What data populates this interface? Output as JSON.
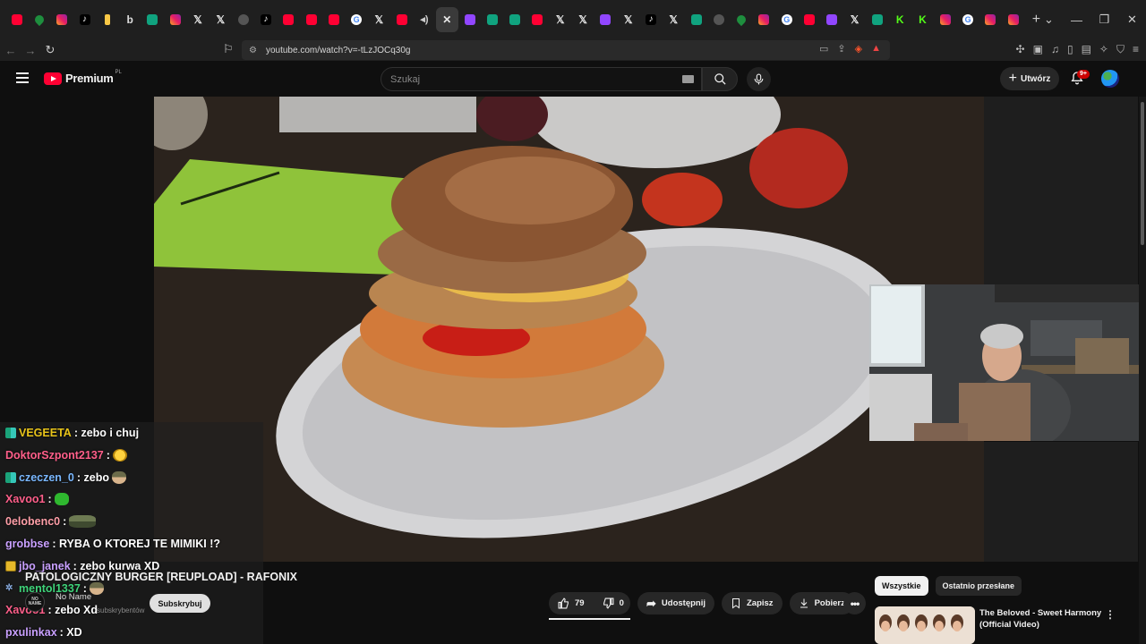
{
  "browser": {
    "tabs": [
      {
        "icon": "youtube-icon",
        "glyph": ""
      },
      {
        "icon": "maps-icon",
        "glyph": ""
      },
      {
        "icon": "instagram-icon",
        "glyph": ""
      },
      {
        "icon": "tiktok-icon",
        "glyph": "♪"
      },
      {
        "icon": "bookmark-gold-icon",
        "glyph": ""
      },
      {
        "icon": "b-icon",
        "glyph": "b"
      },
      {
        "icon": "chatgpt-icon",
        "glyph": ""
      },
      {
        "icon": "instagram-icon",
        "glyph": ""
      },
      {
        "icon": "x-icon",
        "glyph": "𝕏"
      },
      {
        "icon": "x-icon",
        "glyph": "𝕏"
      },
      {
        "icon": "misc-icon",
        "glyph": ""
      },
      {
        "icon": "tiktok-icon",
        "glyph": "♪"
      },
      {
        "icon": "youtube-icon",
        "glyph": ""
      },
      {
        "icon": "youtube-icon",
        "glyph": ""
      },
      {
        "icon": "youtube-icon",
        "glyph": ""
      },
      {
        "icon": "google-icon",
        "glyph": "G"
      },
      {
        "icon": "x-icon",
        "glyph": "𝕏"
      },
      {
        "icon": "youtube-icon",
        "glyph": ""
      },
      {
        "icon": "speaker-icon",
        "glyph": "◂)"
      },
      {
        "icon": "close-tab-icon",
        "glyph": "✕",
        "active": true
      },
      {
        "icon": "twitch-icon",
        "glyph": ""
      },
      {
        "icon": "chatgpt-icon",
        "glyph": ""
      },
      {
        "icon": "chatgpt-icon",
        "glyph": ""
      },
      {
        "icon": "youtube-icon",
        "glyph": ""
      },
      {
        "icon": "x-icon",
        "glyph": "𝕏"
      },
      {
        "icon": "x-icon",
        "glyph": "𝕏"
      },
      {
        "icon": "twitch-icon",
        "glyph": ""
      },
      {
        "icon": "x-icon",
        "glyph": "𝕏"
      },
      {
        "icon": "tiktok-icon",
        "glyph": "♪"
      },
      {
        "icon": "x-icon",
        "glyph": "𝕏"
      },
      {
        "icon": "chatgpt-icon",
        "glyph": ""
      },
      {
        "icon": "misc-icon",
        "glyph": ""
      },
      {
        "icon": "maps-icon",
        "glyph": ""
      },
      {
        "icon": "instagram-icon",
        "glyph": ""
      },
      {
        "icon": "google-icon",
        "glyph": "G"
      },
      {
        "icon": "youtube-icon",
        "glyph": ""
      },
      {
        "icon": "twitch-icon",
        "glyph": ""
      },
      {
        "icon": "x-icon",
        "glyph": "𝕏"
      },
      {
        "icon": "chatgpt-icon",
        "glyph": ""
      },
      {
        "icon": "kick-icon",
        "glyph": "K"
      },
      {
        "icon": "kick-icon",
        "glyph": "K"
      },
      {
        "icon": "instagram-icon",
        "glyph": ""
      },
      {
        "icon": "google-icon",
        "glyph": "G"
      },
      {
        "icon": "instagram-icon",
        "glyph": ""
      },
      {
        "icon": "instagram-icon",
        "glyph": ""
      }
    ],
    "url": "youtube.com/watch?v=-tLzJOCq30g"
  },
  "header": {
    "logo_text": "Premium",
    "logo_region": "PL",
    "search_placeholder": "Szukaj",
    "create_label": "Utwórz",
    "notifications_badge": "9+"
  },
  "chat": [
    {
      "badge": "dual",
      "user": "VEGEETA",
      "user_color": "#e8c41a",
      "msg": ": zebo i chuj",
      "emote": null
    },
    {
      "badge": null,
      "user": "DoktorSzpont2137",
      "user_color": "#ff5f8a",
      "msg": ":",
      "emote": "laugh"
    },
    {
      "badge": "dual",
      "user": "czeczen_0",
      "user_color": "#7ab8ff",
      "msg": ": zebo",
      "emote": "cap"
    },
    {
      "badge": null,
      "user": "Xavoo1",
      "user_color": "#ff5f8a",
      "msg": ":",
      "emote": "green"
    },
    {
      "badge": null,
      "user": "0elobenc0",
      "user_color": "#ff9fa8",
      "msg": ":",
      "emote": "tank"
    },
    {
      "badge": null,
      "user": "grobbse",
      "user_color": "#c9a0ff",
      "msg": ": RYBA O KTOREJ TE MIMIKI !?",
      "emote": null
    },
    {
      "badge": "gold",
      "user": "jbo_janek",
      "user_color": "#c9a0ff",
      "msg": ": zebo kurwa XD",
      "emote": null
    },
    {
      "badge": "bot",
      "user": "mentol1337",
      "user_color": "#3fd47a",
      "msg": ":",
      "emote": "cap"
    },
    {
      "badge": null,
      "user": "Xavoo1",
      "user_color": "#ff5f8a",
      "msg": ": zebo Xd",
      "emote": null
    },
    {
      "badge": null,
      "user": "pxulinkax",
      "user_color": "#c9a0ff",
      "msg": ": XD",
      "emote": null
    }
  ],
  "video": {
    "title": "PATOLOGICZNY BURGER [REUPLOAD] - RAFONIX",
    "channel_name": "No Name",
    "channel_avatar_text": "NO NAME",
    "subscribers": "subskrybentów",
    "subscribe_label": "Subskrybuj",
    "likes": "79",
    "dislikes": "0",
    "share_label": "Udostępnij",
    "save_label": "Zapisz",
    "download_label": "Pobierz"
  },
  "sidebar": {
    "chips": [
      "Wszystkie",
      "Ostatnio przesłane"
    ],
    "recommendation": {
      "title": "The Beloved - Sweet Harmony (Official Video)"
    }
  },
  "colors": {
    "brand_red": "#ff0033",
    "background": "#0f0f0f",
    "pill": "#272727"
  }
}
